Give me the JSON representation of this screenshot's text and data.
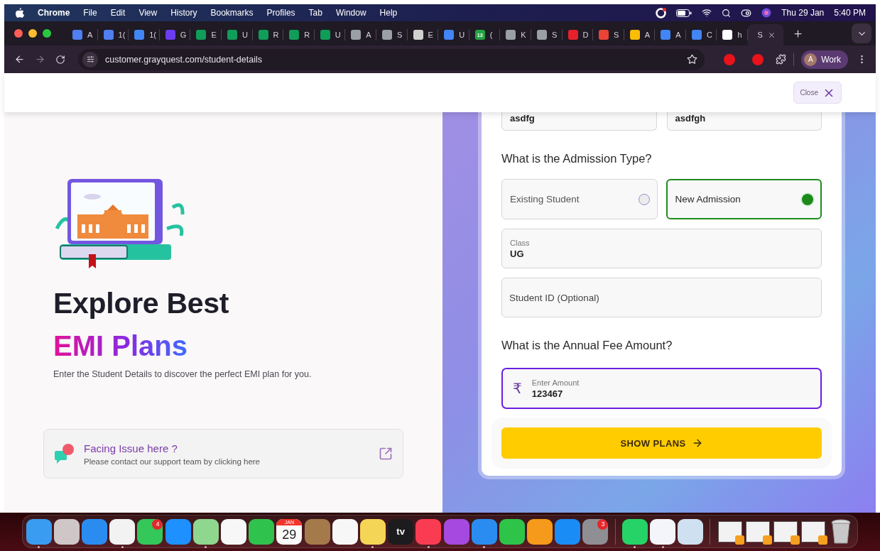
{
  "menu_bar": {
    "app": "Chrome",
    "menus": [
      "File",
      "Edit",
      "View",
      "History",
      "Bookmarks",
      "Profiles",
      "Tab",
      "Window",
      "Help"
    ],
    "date": "Thu 29 Jan",
    "time": "5:40 PM"
  },
  "tabs": [
    {
      "label": "A",
      "selected": false,
      "color": "#4f7ff0"
    },
    {
      "label": "1(",
      "selected": false,
      "color": "#4f7ff0"
    },
    {
      "label": "1(",
      "selected": false,
      "color": "#4285f4"
    },
    {
      "label": "G",
      "selected": false,
      "color": "#6b3cf0"
    },
    {
      "label": "E",
      "selected": false,
      "color": "#0f9d58"
    },
    {
      "label": "U",
      "selected": false,
      "color": "#0f9d58"
    },
    {
      "label": "R",
      "selected": false,
      "color": "#0f9d58"
    },
    {
      "label": "R",
      "selected": false,
      "color": "#0f9d58"
    },
    {
      "label": "U",
      "selected": false,
      "color": "#0f9d58"
    },
    {
      "label": "A",
      "selected": false,
      "color": "#9aa0a6"
    },
    {
      "label": "S",
      "selected": false,
      "color": "#9aa0a6"
    },
    {
      "label": "E",
      "selected": false,
      "color": "#d0d0d0"
    },
    {
      "label": "U",
      "selected": false,
      "color": "#4285f4"
    },
    {
      "label": "(",
      "selected": false,
      "color": "#25a244",
      "badge": "13"
    },
    {
      "label": "K",
      "selected": false,
      "color": "#9aa0a6"
    },
    {
      "label": "S",
      "selected": false,
      "color": "#9aa0a6"
    },
    {
      "label": "D",
      "selected": false,
      "color": "#e8202a"
    },
    {
      "label": "S",
      "selected": false,
      "color": "#ea4335"
    },
    {
      "label": "A",
      "selected": false,
      "color": "#fbbc04"
    },
    {
      "label": "A",
      "selected": false,
      "color": "#4285f4"
    },
    {
      "label": "C",
      "selected": false,
      "color": "#4285f4"
    },
    {
      "label": "h",
      "selected": false,
      "color": "#ffffff"
    },
    {
      "label": "S",
      "selected": true
    }
  ],
  "address_bar": {
    "url": "customer.grayquest.com/student-details",
    "profile_initial": "A",
    "profile": "Work"
  },
  "page": {
    "close": "Close",
    "hero": {
      "title": "Explore Best",
      "highlight": "EMI Plans",
      "subtitle": "Enter the Student Details to discover the perfect EMI plan for you."
    },
    "support": {
      "title": "Facing Issue here ?",
      "text": "Please contact our support team by clicking here"
    },
    "form": {
      "name_fields": [
        {
          "value": "asdfg"
        },
        {
          "value": "asdfgh"
        }
      ],
      "admission_question": "What is the Admission Type?",
      "admission_options": [
        {
          "label": "Existing Student",
          "selected": false
        },
        {
          "label": "New Admission",
          "selected": true
        }
      ],
      "class_field": {
        "label": "Class",
        "value": "UG"
      },
      "student_id": {
        "placeholder": "Student ID (Optional)"
      },
      "fee_question": "What is the Annual Fee Amount?",
      "amount": {
        "currency": "₹",
        "label": "Enter Amount",
        "value": "123467",
        "focused": true
      },
      "submit": "SHOW PLANS"
    }
  },
  "dock": [
    {
      "kind": "app",
      "color": "#3a9cf0",
      "running": true
    },
    {
      "kind": "app",
      "color": "#cfc6c8",
      "running": false
    },
    {
      "kind": "app",
      "color": "#2a8cf0",
      "running": false
    },
    {
      "kind": "app",
      "color": "#f2f2f2",
      "running": true
    },
    {
      "kind": "app",
      "color": "#34c759",
      "running": false,
      "badge": "4"
    },
    {
      "kind": "app",
      "color": "#1e90ff",
      "running": false
    },
    {
      "kind": "app",
      "color": "#8fd68f",
      "running": true
    },
    {
      "kind": "app",
      "color": "#f7f7f7",
      "running": false
    },
    {
      "kind": "app",
      "color": "#2fc24d",
      "running": false
    },
    {
      "kind": "calendar",
      "month": "JAN",
      "day": "29",
      "running": false
    },
    {
      "kind": "app",
      "color": "#a57a4a",
      "running": false
    },
    {
      "kind": "app",
      "color": "#f7f7f7",
      "running": false
    },
    {
      "kind": "app",
      "color": "#f5d556",
      "running": true
    },
    {
      "kind": "tv",
      "label": "tv",
      "running": false
    },
    {
      "kind": "app",
      "color": "#fa3c52",
      "running": true
    },
    {
      "kind": "app",
      "color": "#a649e0",
      "running": false
    },
    {
      "kind": "app",
      "color": "#2a8cf0",
      "running": true
    },
    {
      "kind": "app",
      "color": "#2ec44a",
      "running": false
    },
    {
      "kind": "app",
      "color": "#f59a1a",
      "running": false
    },
    {
      "kind": "app",
      "color": "#1a8cf5",
      "running": false
    },
    {
      "kind": "app",
      "color": "#8e8e93",
      "running": false,
      "badge": "3"
    },
    {
      "kind": "separator"
    },
    {
      "kind": "app",
      "color": "#25d366",
      "running": true
    },
    {
      "kind": "app",
      "color": "#f4f4fb",
      "running": true
    },
    {
      "kind": "app",
      "color": "#cfe0f0",
      "running": false
    },
    {
      "kind": "separator"
    },
    {
      "kind": "document"
    },
    {
      "kind": "document"
    },
    {
      "kind": "document"
    },
    {
      "kind": "document"
    },
    {
      "kind": "trash"
    }
  ]
}
